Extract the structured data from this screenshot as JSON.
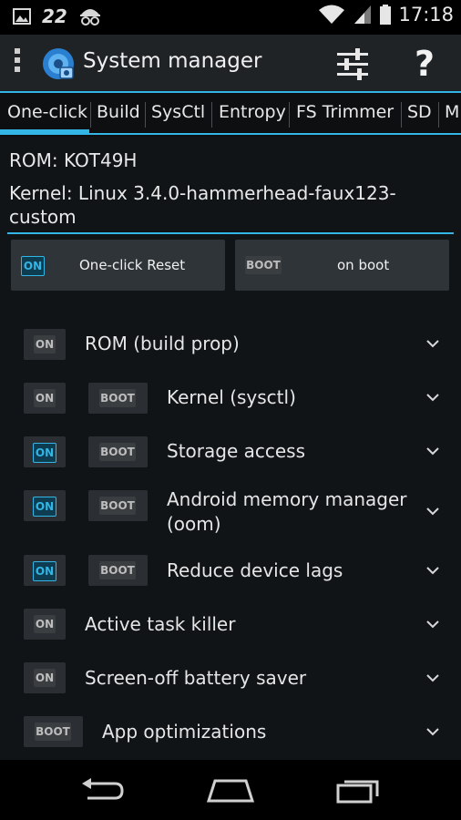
{
  "status_bar": {
    "notification_count": "22",
    "time": "17:18"
  },
  "action_bar": {
    "title": "System manager",
    "help_label": "?"
  },
  "tabs": [
    {
      "label": "One-click",
      "active": true
    },
    {
      "label": "Build"
    },
    {
      "label": "SysCtl"
    },
    {
      "label": "Entropy"
    },
    {
      "label": "FS Trimmer"
    },
    {
      "label": "SD"
    },
    {
      "label": "M"
    }
  ],
  "info": {
    "rom": "ROM: KOT49H",
    "kernel_line1": "Kernel: Linux 3.4.0-hammerhead-faux123-",
    "kernel_line2": "custom"
  },
  "top_buttons": {
    "reset_badge": "ON",
    "reset_label": "One-click Reset",
    "boot_badge": "BOOT",
    "boot_label": "on boot"
  },
  "rows": [
    {
      "on_badge": "ON",
      "on_active": false,
      "label": "ROM (build prop)"
    },
    {
      "on_badge": "ON",
      "on_active": false,
      "boot_badge": "BOOT",
      "label": "Kernel (sysctl)"
    },
    {
      "on_badge": "ON",
      "on_active": true,
      "boot_badge": "BOOT",
      "label": "Storage access"
    },
    {
      "on_badge": "ON",
      "on_active": true,
      "boot_badge": "BOOT",
      "label_line1": "Android memory manager",
      "label_line2": "(oom)"
    },
    {
      "on_badge": "ON",
      "on_active": true,
      "boot_badge": "BOOT",
      "label": "Reduce device lags"
    },
    {
      "on_badge": "ON",
      "on_active": false,
      "label": "Active task killer"
    },
    {
      "on_badge": "ON",
      "on_active": false,
      "label": "Screen-off battery saver"
    },
    {
      "boot_badge": "BOOT",
      "label": "App optimizations"
    }
  ],
  "colors": {
    "accent": "#33b5e5",
    "background": "#111417",
    "action_bar": "#1f2326"
  },
  "icons": [
    "image-icon",
    "notification-counter",
    "incognito-icon",
    "wifi-icon",
    "signal-icon",
    "battery-icon",
    "overflow-menu-icon",
    "system-manager-app-icon",
    "tune-settings-icon",
    "help-icon",
    "chevron-down-icon",
    "back-nav-icon",
    "home-nav-icon",
    "recents-nav-icon"
  ]
}
